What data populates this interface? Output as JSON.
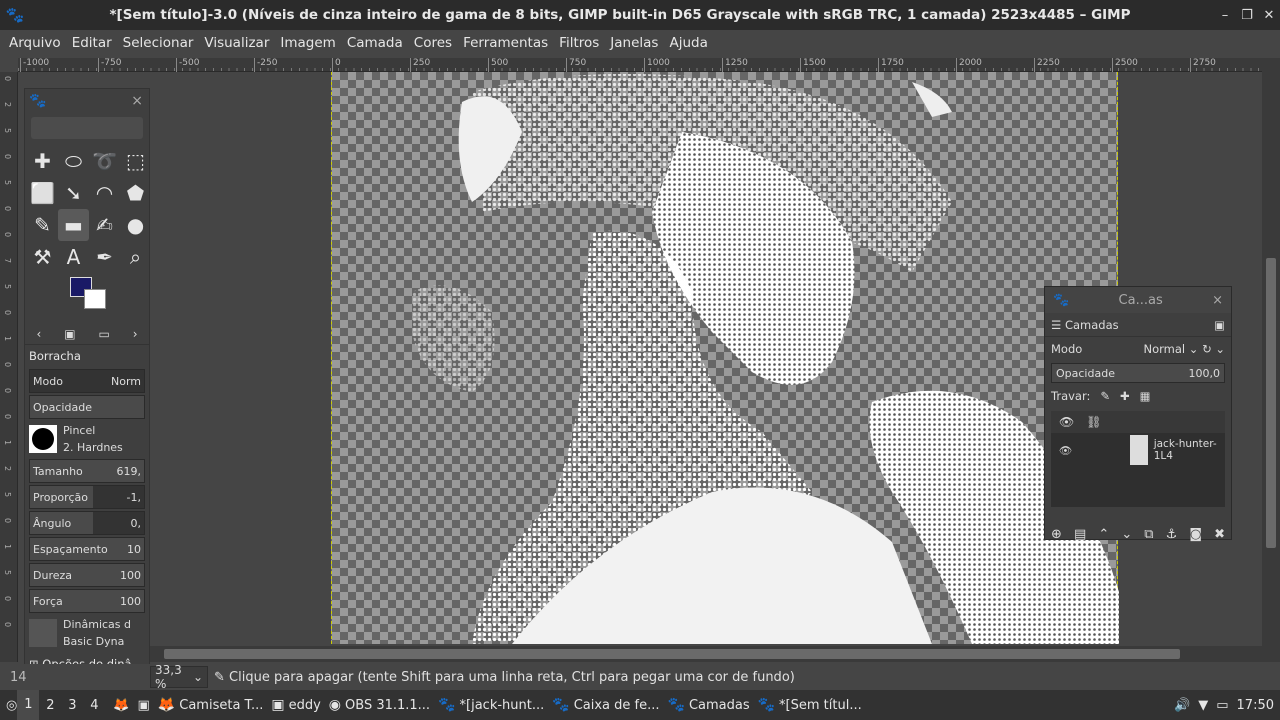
{
  "window": {
    "title": "*[Sem título]-3.0 (Níveis de cinza inteiro de gama de 8 bits, GIMP built-in D65 Grayscale with sRGB TRC, 1 camada) 2523x4485 – GIMP",
    "controls": [
      "–",
      "❐",
      "✕"
    ]
  },
  "menu": [
    "Arquivo",
    "Editar",
    "Selecionar",
    "Visualizar",
    "Imagem",
    "Camada",
    "Cores",
    "Ferramentas",
    "Filtros",
    "Janelas",
    "Ajuda"
  ],
  "ruler": {
    "h_ticks": [
      "-1000",
      "-750",
      "-500",
      "-250",
      "0",
      "250",
      "500",
      "750",
      "1000",
      "1250",
      "1500",
      "1750",
      "2000",
      "2250",
      "2500",
      "2750"
    ],
    "v_ticks": [
      "0",
      "2",
      "5",
      "0",
      "5",
      "0",
      "0",
      "7",
      "5",
      "0",
      "1",
      "0",
      "0",
      "0",
      "1",
      "2",
      "5",
      "0",
      "1",
      "5",
      "0",
      "0"
    ]
  },
  "toolbox": {
    "tools": [
      "✚",
      "⬭",
      "➰",
      "⬚",
      "⬜",
      "➘",
      "◠",
      "⬟",
      "✎",
      "▬",
      "✍",
      "●",
      "⚒",
      "A",
      "✒",
      "⌕"
    ],
    "tool_names": [
      "move-tool",
      "ellipse-select",
      "free-select",
      "fuzzy-select",
      "crop-tool",
      "transform-tool",
      "warp-tool",
      "bucket-fill",
      "paintbrush",
      "eraser",
      "heal-tool",
      "smudge",
      "cage-tool",
      "text-tool",
      "color-picker",
      "zoom-tool"
    ],
    "active_tool": 9,
    "options_title": "Borracha",
    "mode_label": "Modo",
    "mode_value": "Norm",
    "opacity_label": "Opacidade",
    "brush_label": "Pincel",
    "brush_value": "2. Hardnes",
    "size_label": "Tamanho",
    "size_value": "619,",
    "ratio_label": "Proporção",
    "ratio_value": "-1,",
    "angle_label": "Ângulo",
    "angle_value": "0,",
    "spacing_label": "Espaçamento",
    "spacing_value": "10",
    "hardness_label": "Dureza",
    "hardness_value": "100",
    "force_label": "Força",
    "force_value": "100",
    "dynamics_label": "Dinâmicas d",
    "dynamics_value": "Basic Dyna",
    "dynamics_options": "Opções de dinâ"
  },
  "layers": {
    "title": "Ca...as",
    "tab": "Camadas",
    "mode_label": "Modo",
    "mode_value": "Normal",
    "opacity_label": "Opacidade",
    "opacity_value": "100,0",
    "lock_label": "Travar:",
    "layer_name": "jack-hunter-1L4"
  },
  "status": {
    "unit": "14",
    "zoom": "33,3 %",
    "message": "Clique para apagar (tente Shift para uma linha reta, Ctrl para pegar uma cor de fundo)"
  },
  "taskbar": {
    "workspaces": [
      "1",
      "2",
      "3",
      "4"
    ],
    "items": [
      "Camiseta T...",
      "eddy",
      "OBS 31.1.1...",
      "*[jack-hunt...",
      "Caixa de fe...",
      "Camadas",
      "*[Sem títul..."
    ],
    "clock": "17:50"
  }
}
